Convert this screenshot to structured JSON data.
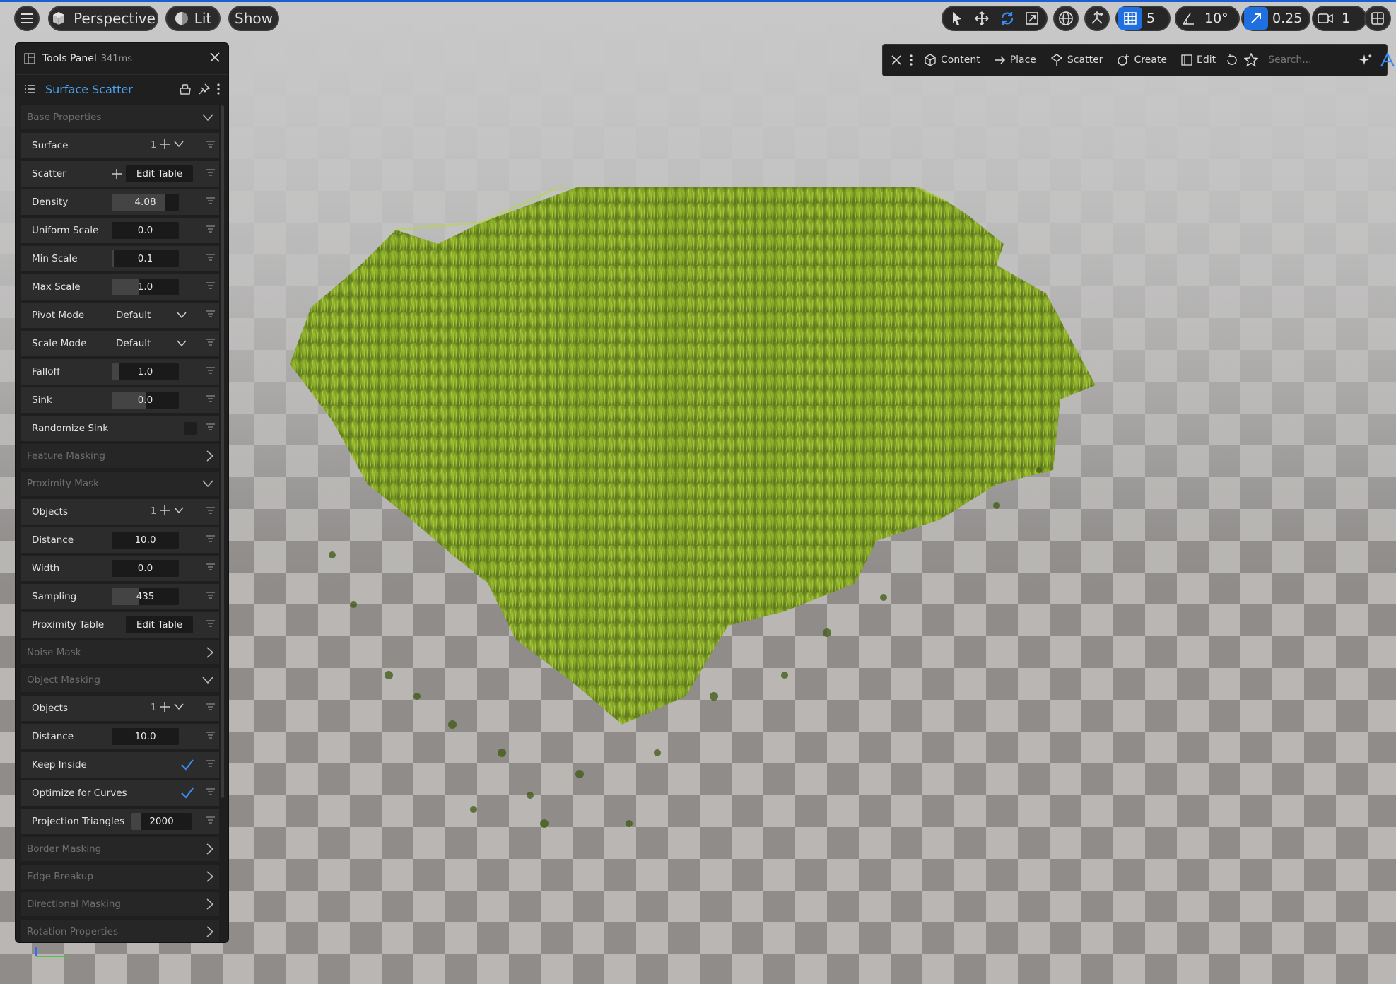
{
  "toolbar": {
    "perspective_label": "Perspective",
    "lit_label": "Lit",
    "show_label": "Show",
    "grid_snap_value": "5",
    "angle_snap_value": "10°",
    "scale_snap_value": "0.25",
    "camera_speed_value": "1"
  },
  "mode_bar": {
    "content_label": "Content",
    "place_label": "Place",
    "scatter_label": "Scatter",
    "create_label": "Create",
    "edit_label": "Edit",
    "search_placeholder": "Search..."
  },
  "panel": {
    "title": "Tools Panel",
    "timing": "341ms",
    "tool_name": "Surface Scatter",
    "sections": {
      "base": "Base Properties",
      "feature_masking": "Feature Masking",
      "proximity_mask": "Proximity Mask",
      "noise_mask": "Noise Mask",
      "object_masking": "Object Masking",
      "border_masking": "Border Masking",
      "edge_breakup": "Edge Breakup",
      "directional_masking": "Directional Masking",
      "rotation_properties": "Rotation Properties"
    },
    "base": {
      "surface_label": "Surface",
      "surface_count": "1",
      "scatter_label": "Scatter",
      "scatter_button": "Edit Table",
      "density_label": "Density",
      "density_value": "4.08",
      "density_fill": 0.8,
      "uniform_scale_label": "Uniform Scale",
      "uniform_scale_value": "0.0",
      "uniform_scale_fill": 0.0,
      "min_scale_label": "Min Scale",
      "min_scale_value": "0.1",
      "min_scale_fill": 0.03,
      "max_scale_label": "Max Scale",
      "max_scale_value": "1.0",
      "max_scale_fill": 0.4,
      "pivot_mode_label": "Pivot Mode",
      "pivot_mode_value": "Default",
      "scale_mode_label": "Scale Mode",
      "scale_mode_value": "Default",
      "falloff_label": "Falloff",
      "falloff_value": "1.0",
      "falloff_fill": 0.1,
      "sink_label": "Sink",
      "sink_value": "0.0",
      "sink_fill": 0.5,
      "randomize_sink_label": "Randomize Sink"
    },
    "proximity": {
      "objects_label": "Objects",
      "objects_count": "1",
      "distance_label": "Distance",
      "distance_value": "10.0",
      "width_label": "Width",
      "width_value": "0.0",
      "sampling_label": "Sampling",
      "sampling_value": "435",
      "sampling_fill": 0.4,
      "table_label": "Proximity Table",
      "table_button": "Edit Table"
    },
    "object_masking": {
      "objects_label": "Objects",
      "objects_count": "1",
      "distance_label": "Distance",
      "distance_value": "10.0",
      "keep_inside_label": "Keep Inside",
      "keep_inside_checked": true,
      "optimize_label": "Optimize for Curves",
      "optimize_checked": true,
      "projection_label": "Projection Triangles",
      "projection_value": "2000",
      "projection_fill": 0.15
    }
  },
  "colors": {
    "accent": "#1f6fe0",
    "panel_bg": "#1f1f1f",
    "tool_name": "#4aa3f0",
    "grass": "#8fb02a"
  }
}
